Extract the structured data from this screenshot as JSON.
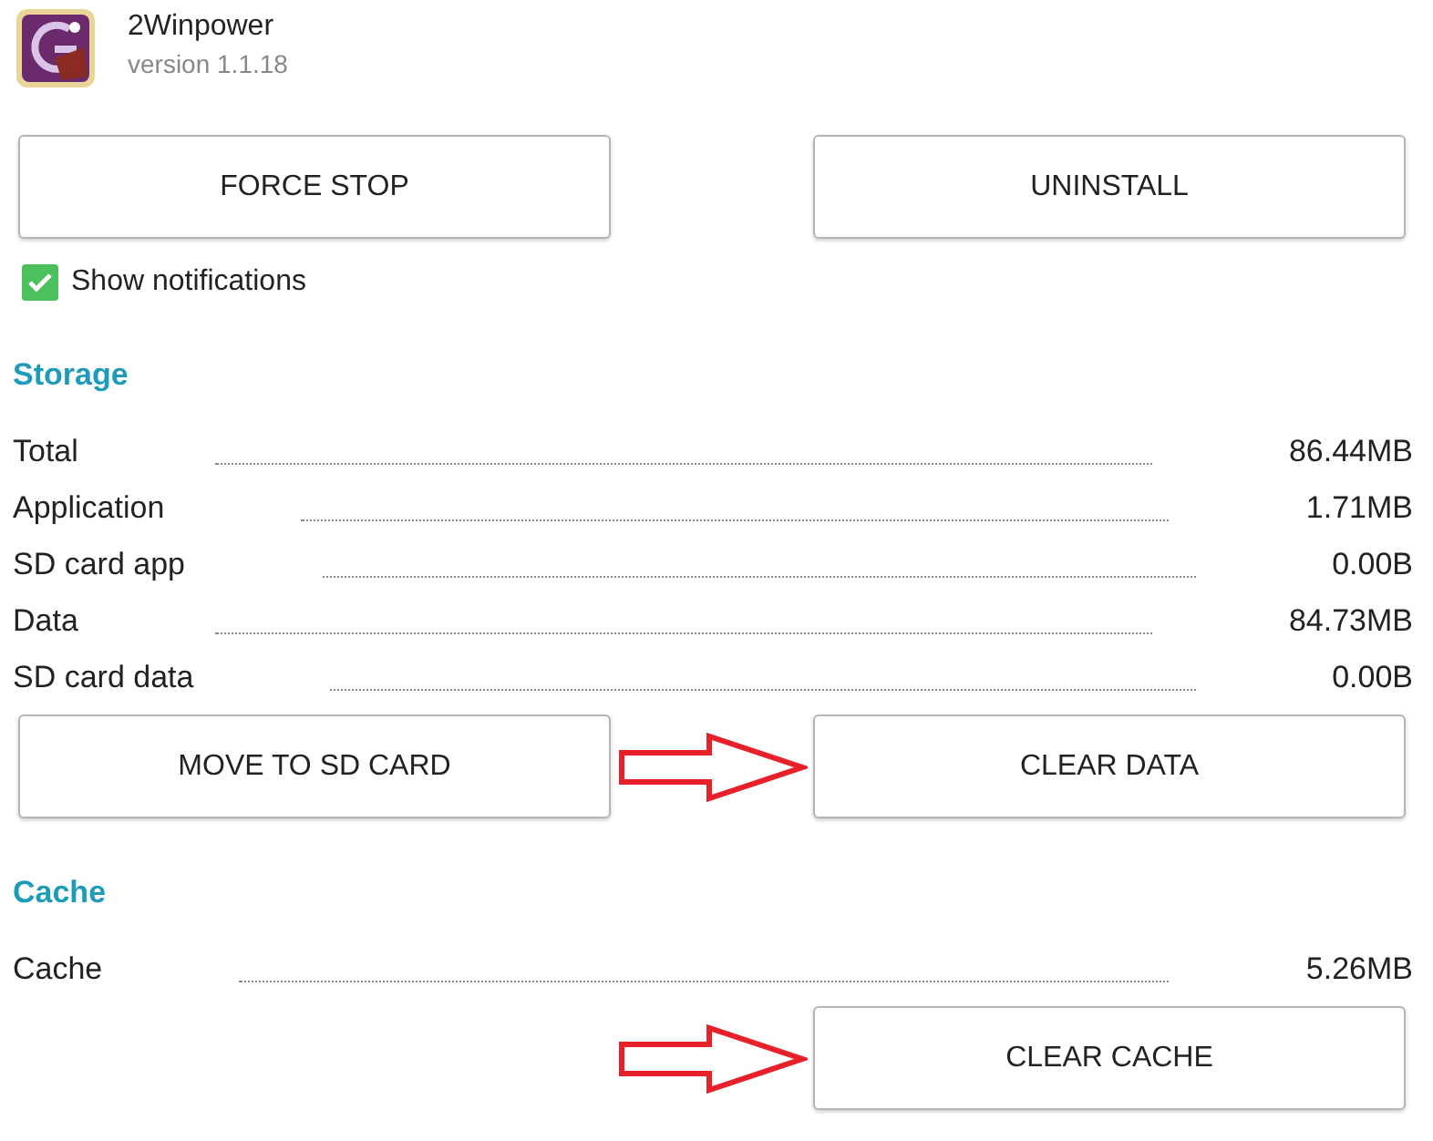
{
  "app": {
    "name": "2Winpower",
    "version": "version 1.1.18"
  },
  "top_buttons": [
    {
      "label": "FORCE STOP"
    },
    {
      "label": "UNINSTALL"
    }
  ],
  "notifications": {
    "label": "Show notifications",
    "checked": true
  },
  "storage": {
    "title": "Storage",
    "rows": [
      {
        "label": "Total",
        "value": "86.44MB"
      },
      {
        "label": "Application",
        "value": "1.71MB"
      },
      {
        "label": "SD card app",
        "value": "0.00B"
      },
      {
        "label": "Data",
        "value": "84.73MB"
      },
      {
        "label": "SD card data",
        "value": "0.00B"
      }
    ],
    "arrow_to_button": true,
    "buttons": [
      {
        "label": "MOVE TO SD CARD"
      },
      {
        "label": "CLEAR DATA"
      }
    ]
  },
  "cache": {
    "title": "Cache",
    "rows": [
      {
        "label": "Cache",
        "value": "5.26MB"
      }
    ],
    "arrow_to_button": true,
    "buttons": [
      {
        "label": "CLEAR CACHE"
      }
    ]
  }
}
